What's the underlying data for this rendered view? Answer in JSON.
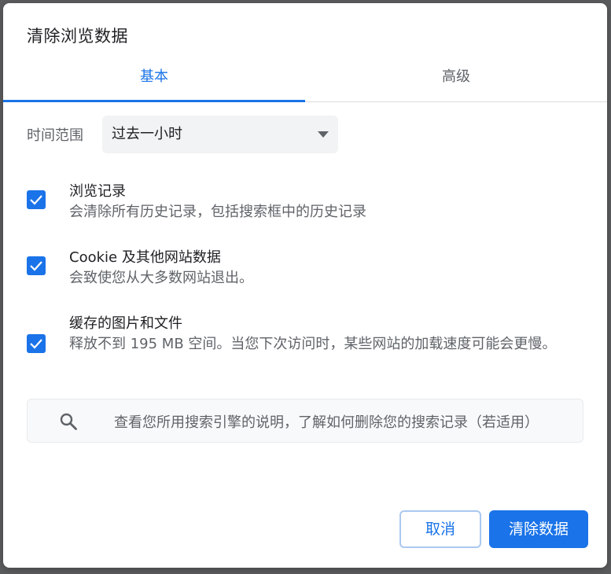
{
  "dialog": {
    "title": "清除浏览数据",
    "tabs": [
      {
        "label": "基本",
        "selected": true
      },
      {
        "label": "高级",
        "selected": false
      }
    ],
    "time_range": {
      "label": "时间范围",
      "selected": "过去一小时"
    },
    "items": [
      {
        "title": "浏览记录",
        "description": "会清除所有历史记录，包括搜索框中的历史记录",
        "checked": true
      },
      {
        "title": "Cookie 及其他网站数据",
        "description": "会致使您从大多数网站退出。",
        "checked": true
      },
      {
        "title": "缓存的图片和文件",
        "description": "释放不到 195 MB 空间。当您下次访问时，某些网站的加载速度可能会更慢。",
        "checked": true
      }
    ],
    "search_link": {
      "icon": "search-icon",
      "text": "查看您所用搜索引擎的说明，了解如何删除您的搜索记录（若适用）"
    },
    "buttons": {
      "cancel": "取消",
      "clear": "清除数据"
    }
  },
  "colors": {
    "accent": "#1a73e8",
    "text_primary": "#202124",
    "text_secondary": "#5f6368"
  }
}
